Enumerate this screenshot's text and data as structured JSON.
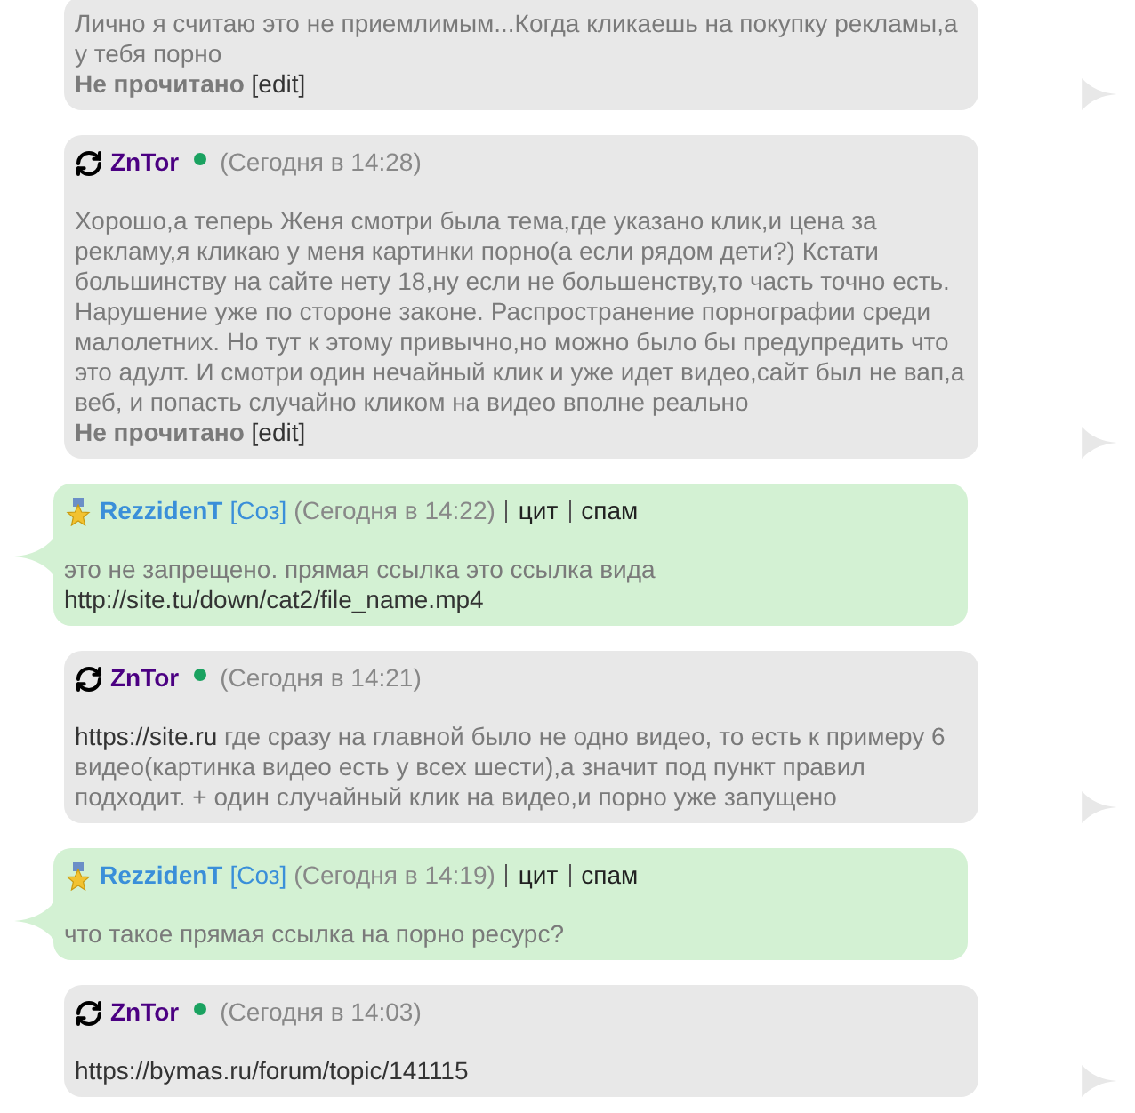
{
  "messages": [
    {
      "kind": "outgoing",
      "body": [
        {
          "kind": "text",
          "text": "Лично я считаю это не приемлимым...Когда кликаешь на покупку рекламы,а у тебя порно"
        }
      ],
      "status": "Не прочитано",
      "edit": "[edit]"
    },
    {
      "kind": "outgoing",
      "author": {
        "name": "ZnTor",
        "color": "#4b0082",
        "avatar": {
          "kind": "sync"
        },
        "online": true
      },
      "time": "(Сегодня в 14:28)",
      "body": [
        {
          "kind": "text",
          "text": "Хорошо,а теперь Женя смотри была тема,где указано клик,и цена за рекламу,я кликаю у меня картинки порно(а если рядом дети?) Кстати большинству на сайте нету 18,ну если не большенству,то часть точно есть. Нарушение уже по стороне законе. Распространение порнографии среди малолетних. Но тут к этому привычно,но можно было бы предупредить что это адулт. И смотри один нечайный клик и уже идет видео,сайт был не вап,а веб, и попасть случайно кликом на видео вполне реально"
        }
      ],
      "status": "Не прочитано",
      "edit": "[edit]"
    },
    {
      "kind": "incoming",
      "author": {
        "name": "RezzidenT",
        "color": "#3a8fd9",
        "avatar": {
          "kind": "medal"
        },
        "online": false
      },
      "role": "[Соз]",
      "time": "(Сегодня в 14:22)",
      "actions": [
        "цит",
        "спам"
      ],
      "body": [
        {
          "kind": "text",
          "text": "это не запрещено. прямая ссылка это ссылка вида"
        },
        {
          "kind": "link",
          "text": "http://site.tu/down/cat2/file_name.mp4"
        }
      ]
    },
    {
      "kind": "outgoing",
      "author": {
        "name": "ZnTor",
        "color": "#4b0082",
        "avatar": {
          "kind": "sync"
        },
        "online": true
      },
      "time": "(Сегодня в 14:21)",
      "body": [
        {
          "kind": "link",
          "text": "https://site.ru"
        },
        {
          "kind": "text",
          "text": "где сразу на главной было не одно видео, то есть к примеру 6 видео(картинка видео есть у всех шести),а значит под пункт правил подходит. + один случайный клик на видео,и порно уже запущено"
        }
      ]
    },
    {
      "kind": "incoming",
      "author": {
        "name": "RezzidenT",
        "color": "#3a8fd9",
        "avatar": {
          "kind": "medal"
        },
        "online": false
      },
      "role": "[Соз]",
      "time": "(Сегодня в 14:19)",
      "actions": [
        "цит",
        "спам"
      ],
      "body": [
        {
          "kind": "text",
          "text": "что такое прямая ссылка на порно ресурс?"
        }
      ]
    },
    {
      "kind": "outgoing",
      "author": {
        "name": "ZnTor",
        "color": "#4b0082",
        "avatar": {
          "kind": "sync"
        },
        "online": true
      },
      "time": "(Сегодня в 14:03)",
      "body": [
        {
          "kind": "link",
          "text": "https://bymas.ru/forum/topic/141115"
        }
      ]
    }
  ]
}
